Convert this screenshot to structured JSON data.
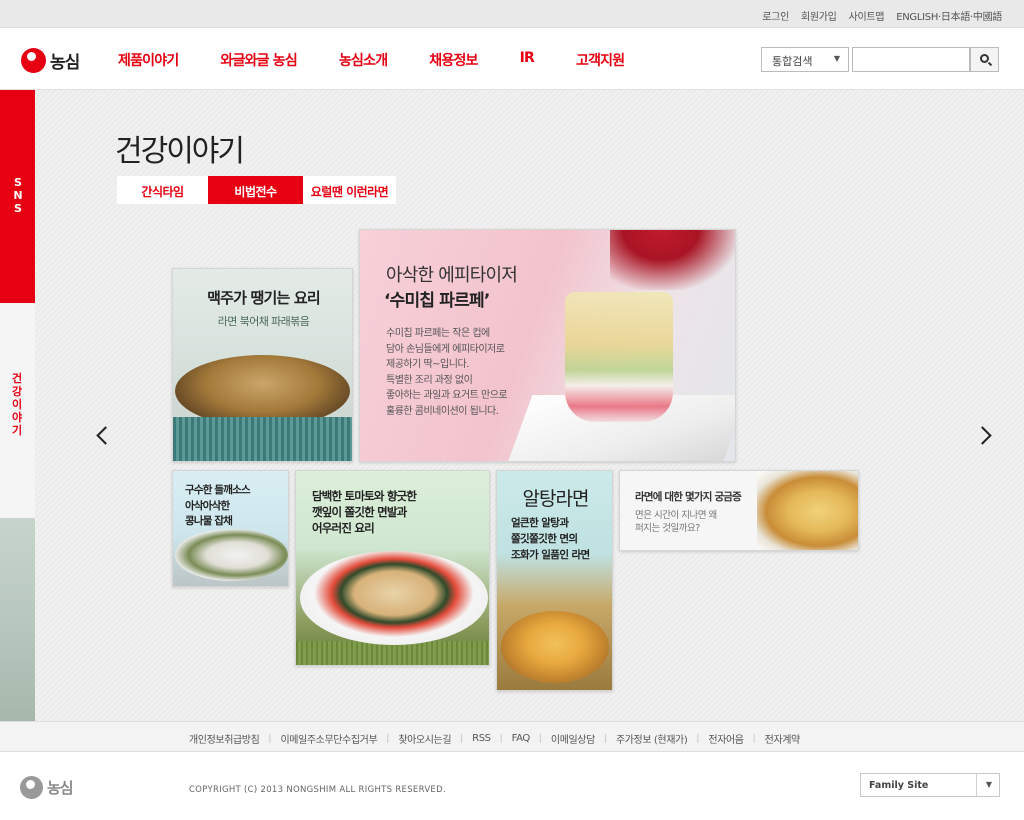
{
  "util_links": [
    "로그인",
    "회원가입",
    "사이트맵",
    "ENGLISH·日本語·中國語"
  ],
  "header": {
    "logo_text": "농심",
    "nav": [
      "제품이야기",
      "와글와글 농심",
      "농심소개",
      "채용정보",
      "IR",
      "고객지원"
    ],
    "search_select": "통합검색",
    "search_input_value": ""
  },
  "sidebar": {
    "sns_label": "SNS",
    "story_label": "건강이야기"
  },
  "main": {
    "title": "건강이야기",
    "tabs": [
      {
        "label": "간식타임",
        "active": false
      },
      {
        "label": "비법전수",
        "active": true
      },
      {
        "label": "요럴땐 이런라면",
        "active": false
      }
    ]
  },
  "cards": {
    "beer": {
      "title": "맥주가 땡기는 요리",
      "subtitle": "라면 북어채 파래볶음"
    },
    "feature": {
      "title1": "아삭한 에피타이저",
      "title2": "‘수미칩 파르페’",
      "desc": [
        "수미칩 파르페는 작은 컵에",
        "담아 손님들에게 에피타이저로",
        "제공하기 딱~입니다.",
        "특별한 조리 과정 없이",
        "좋아하는 과일과 요거트 만으로",
        "훌륭한 콤비네이션이 됩니다."
      ]
    },
    "sprouts": {
      "lines": [
        "구수한 들깨소스",
        "아삭아삭한",
        "콩나물 잡채"
      ]
    },
    "tomato": {
      "lines": [
        "담백한 토마토와 향긋한",
        "깻잎이 쫄깃한 면발과",
        "어우러진 요리"
      ]
    },
    "altang": {
      "title": "알탕라면",
      "lines": [
        "얼큰한 알탕과",
        "쫄깃쫄깃한 면의",
        "조화가 일품인 라면"
      ]
    },
    "question": {
      "title": "라면에 대한 몇가지 궁금증",
      "lines": [
        "면은 시간이 지나면 왜",
        "퍼지는 것일까요?"
      ]
    }
  },
  "footer": {
    "links": [
      "개인정보취급방침",
      "이메일주소무단수집거부",
      "찾아오시는길",
      "RSS",
      "FAQ",
      "이메일상담",
      "주가정보 (현재가)",
      "전자어음",
      "전자계약"
    ],
    "logo_text": "농심",
    "copyright": "COPYRIGHT (C) 2013 NONGSHIM ALL RIGHTS RESERVED.",
    "family_site": "Family Site"
  },
  "colors": {
    "brand_red": "#e60012"
  },
  "icons": {
    "search": "search-icon",
    "prev": "chevron-left-icon",
    "next": "chevron-right-icon",
    "dropdown": "caret-down-icon"
  }
}
